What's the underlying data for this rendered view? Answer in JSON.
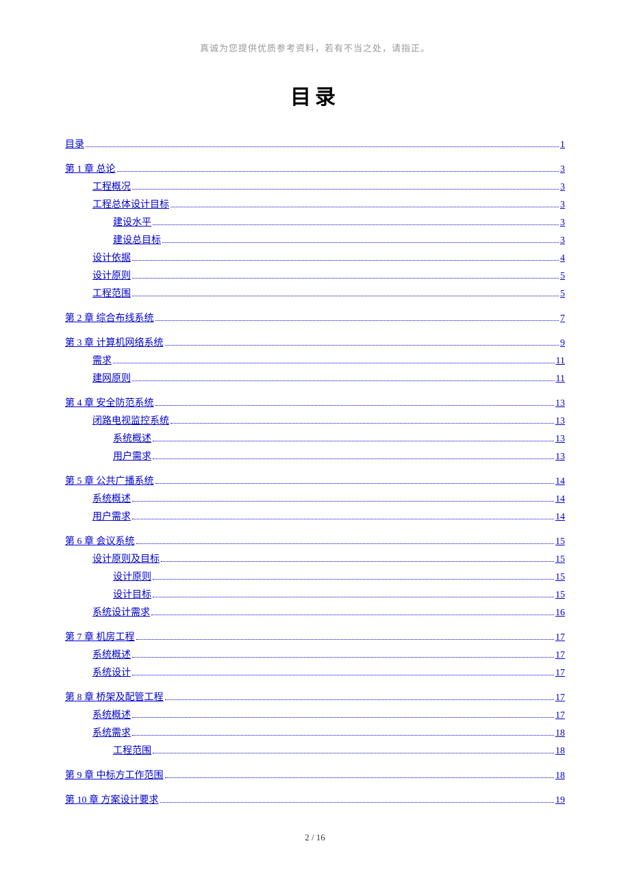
{
  "header_note": "真诚为您提供优质参考资料，若有不当之处，请指正。",
  "title": "目录",
  "footer": "2 / 16",
  "toc": [
    {
      "level": 0,
      "label": "目录",
      "page": "1"
    },
    {
      "level": 0,
      "label": "第 1 章  总论",
      "page": "3"
    },
    {
      "level": 1,
      "label": "工程概况",
      "page": "3"
    },
    {
      "level": 1,
      "label": "工程总体设计目标",
      "page": "3"
    },
    {
      "level": 2,
      "label": "建设水平",
      "page": "3"
    },
    {
      "level": 2,
      "label": "建设总目标",
      "page": "3"
    },
    {
      "level": 1,
      "label": "设计依据",
      "page": "4"
    },
    {
      "level": 1,
      "label": "设计原则",
      "page": "5"
    },
    {
      "level": 1,
      "label": "工程范围",
      "page": "5"
    },
    {
      "level": 0,
      "label": "第 2 章  综合布线系统",
      "page": "7"
    },
    {
      "level": 0,
      "label": "第 3 章  计算机网络系统",
      "page": "9"
    },
    {
      "level": 1,
      "label": "需求",
      "page": "11"
    },
    {
      "level": 1,
      "label": "建网原则",
      "page": "11"
    },
    {
      "level": 0,
      "label": "第 4 章  安全防范系统",
      "page": "13"
    },
    {
      "level": 1,
      "label": "闭路电视监控系统",
      "page": "13"
    },
    {
      "level": 2,
      "label": "系统概述",
      "page": "13"
    },
    {
      "level": 2,
      "label": "用户需求",
      "page": "13"
    },
    {
      "level": 0,
      "label": "第 5 章  公共广播系统",
      "page": "14"
    },
    {
      "level": 1,
      "label": "系统概述",
      "page": "14"
    },
    {
      "level": 1,
      "label": "用户需求",
      "page": "14"
    },
    {
      "level": 0,
      "label": "第 6 章  会议系统",
      "page": "15"
    },
    {
      "level": 1,
      "label": "设计原则及目标",
      "page": "15"
    },
    {
      "level": 2,
      "label": "设计原则",
      "page": "15"
    },
    {
      "level": 2,
      "label": "设计目标",
      "page": "15"
    },
    {
      "level": 1,
      "label": "系统设计需求",
      "page": "16"
    },
    {
      "level": 0,
      "label": "第 7 章  机房工程",
      "page": "17"
    },
    {
      "level": 1,
      "label": "系统概述",
      "page": "17"
    },
    {
      "level": 1,
      "label": "系统设计",
      "page": "17"
    },
    {
      "level": 0,
      "label": "第 8 章  桥架及配管工程",
      "page": "17"
    },
    {
      "level": 1,
      "label": "系统概述",
      "page": "17"
    },
    {
      "level": 1,
      "label": "系统需求",
      "page": "18"
    },
    {
      "level": 2,
      "label": "工程范围",
      "page": "18"
    },
    {
      "level": 0,
      "label": "第 9 章  中标方工作范围",
      "page": "18"
    },
    {
      "level": 0,
      "label": "第 10 章  方案设计要求",
      "page": "19"
    }
  ]
}
